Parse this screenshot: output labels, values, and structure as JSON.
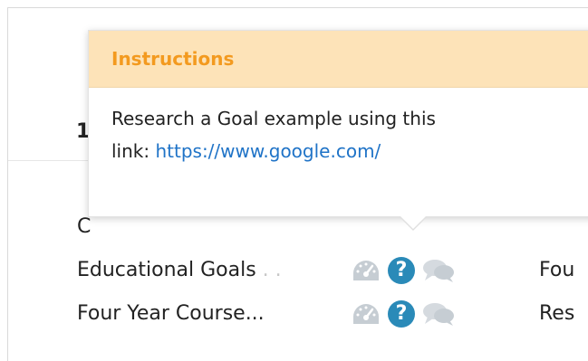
{
  "section": {
    "number_label": "1"
  },
  "rows": [
    {
      "name": "C",
      "dots": "",
      "right": ""
    },
    {
      "name": "Educational Goals",
      "dots": " . .",
      "right": "Fou"
    },
    {
      "name": "Four Year Course...",
      "dots": "",
      "right": "Res"
    }
  ],
  "popover": {
    "title": "Instructions",
    "text_line1": "Research a Goal example using this",
    "text_prefix": "link: ",
    "link": "https://www.google.com/"
  },
  "icons": {
    "gauge": "gauge-icon",
    "help": "question-icon",
    "help_glyph": "?",
    "chat": "chat-bubbles-icon"
  },
  "colors": {
    "popover_header_bg": "#fde3b8",
    "popover_title": "#f39a1f",
    "link": "#1f73c7",
    "help_icon": "#2a8ab8",
    "muted_icon": "#c6cdd3"
  }
}
